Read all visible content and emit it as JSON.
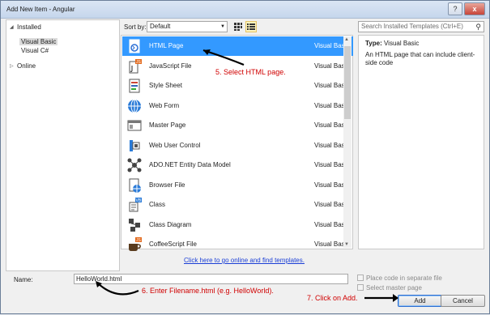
{
  "window": {
    "title": "Add New Item - Angular",
    "buttons": {
      "help": "?",
      "close": "x"
    }
  },
  "toolbar": {
    "sort_label": "Sort by:",
    "sort_value": "Default",
    "search_placeholder": "Search Installed Templates (Ctrl+E)"
  },
  "tree": {
    "installed": "Installed",
    "children": [
      "Visual Basic",
      "Visual C#"
    ],
    "online": "Online"
  },
  "templates": [
    {
      "name": "HTML Page",
      "type": "Visual Basic",
      "icon": "html-page-icon",
      "selected": true
    },
    {
      "name": "JavaScript File",
      "type": "Visual Basic",
      "icon": "javascript-file-icon"
    },
    {
      "name": "Style Sheet",
      "type": "Visual Basic",
      "icon": "style-sheet-icon"
    },
    {
      "name": "Web Form",
      "type": "Visual Basic",
      "icon": "web-form-icon"
    },
    {
      "name": "Master Page",
      "type": "Visual Basic",
      "icon": "master-page-icon"
    },
    {
      "name": "Web User Control",
      "type": "Visual Basic",
      "icon": "web-user-control-icon"
    },
    {
      "name": "ADO.NET Entity Data Model",
      "type": "Visual Basic",
      "icon": "entity-data-model-icon"
    },
    {
      "name": "Browser File",
      "type": "Visual Basic",
      "icon": "browser-file-icon"
    },
    {
      "name": "Class",
      "type": "Visual Basic",
      "icon": "class-icon"
    },
    {
      "name": "Class Diagram",
      "type": "Visual Basic",
      "icon": "class-diagram-icon"
    },
    {
      "name": "CoffeeScript File",
      "type": "Visual Basic",
      "icon": "coffeescript-file-icon"
    }
  ],
  "online_link": "Click here to go online and find templates.",
  "details": {
    "type_label": "Type:",
    "type_value": "Visual Basic",
    "description": "An HTML page that can include client-side code"
  },
  "form": {
    "name_label": "Name:",
    "name_value": "HelloWorld.html",
    "place_code_label": "Place code in separate file",
    "select_master_label": "Select master page",
    "add_label": "Add",
    "cancel_label": "Cancel"
  },
  "annotations": {
    "step5": "5. Select HTML page.",
    "step6": "6. Enter Filename.html (e.g. HelloWorld).",
    "step7": "7. Click on Add."
  },
  "colors": {
    "selection": "#3399ff",
    "annotation": "#d00000",
    "link": "#1a3ed6"
  }
}
